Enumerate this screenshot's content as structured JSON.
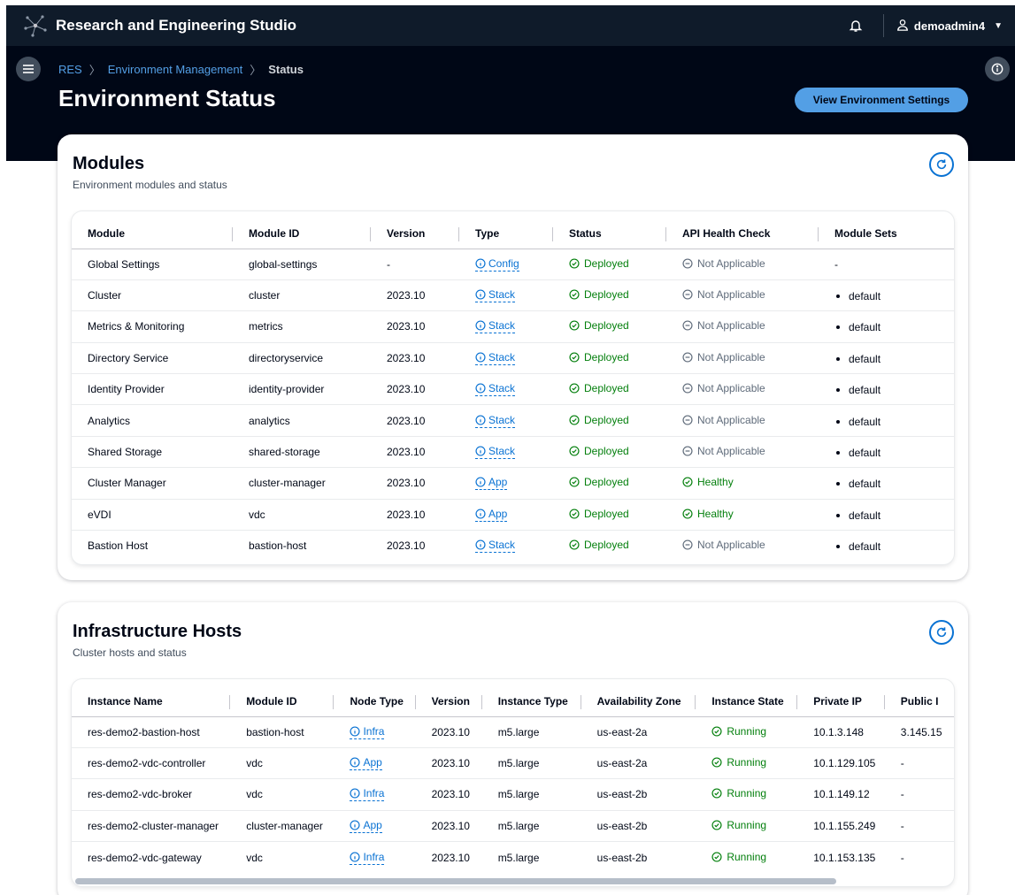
{
  "topnav": {
    "title": "Research and Engineering Studio",
    "user": "demoadmin4"
  },
  "breadcrumb": {
    "root": "RES",
    "parent": "Environment Management",
    "current": "Status"
  },
  "page": {
    "title": "Environment Status",
    "primary_button": "View Environment Settings"
  },
  "modules": {
    "title": "Modules",
    "description": "Environment modules and status",
    "columns": [
      "Module",
      "Module ID",
      "Version",
      "Type",
      "Status",
      "API Health Check",
      "Module Sets"
    ],
    "rows": [
      [
        "Global Settings",
        "global-settings",
        "-",
        "Config",
        "Deployed",
        "Not Applicable",
        "-"
      ],
      [
        "Cluster",
        "cluster",
        "2023.10",
        "Stack",
        "Deployed",
        "Not Applicable",
        "default"
      ],
      [
        "Metrics & Monitoring",
        "metrics",
        "2023.10",
        "Stack",
        "Deployed",
        "Not Applicable",
        "default"
      ],
      [
        "Directory Service",
        "directoryservice",
        "2023.10",
        "Stack",
        "Deployed",
        "Not Applicable",
        "default"
      ],
      [
        "Identity Provider",
        "identity-provider",
        "2023.10",
        "Stack",
        "Deployed",
        "Not Applicable",
        "default"
      ],
      [
        "Analytics",
        "analytics",
        "2023.10",
        "Stack",
        "Deployed",
        "Not Applicable",
        "default"
      ],
      [
        "Shared Storage",
        "shared-storage",
        "2023.10",
        "Stack",
        "Deployed",
        "Not Applicable",
        "default"
      ],
      [
        "Cluster Manager",
        "cluster-manager",
        "2023.10",
        "App",
        "Deployed",
        "Healthy",
        "default"
      ],
      [
        "eVDI",
        "vdc",
        "2023.10",
        "App",
        "Deployed",
        "Healthy",
        "default"
      ],
      [
        "Bastion Host",
        "bastion-host",
        "2023.10",
        "Stack",
        "Deployed",
        "Not Applicable",
        "default"
      ]
    ]
  },
  "hosts": {
    "title": "Infrastructure Hosts",
    "description": "Cluster hosts and status",
    "columns": [
      "Instance Name",
      "Module ID",
      "Node Type",
      "Version",
      "Instance Type",
      "Availability Zone",
      "Instance State",
      "Private IP",
      "Public I"
    ],
    "rows": [
      [
        "res-demo2-bastion-host",
        "bastion-host",
        "Infra",
        "2023.10",
        "m5.large",
        "us-east-2a",
        "Running",
        "10.1.3.148",
        "3.145.15"
      ],
      [
        "res-demo2-vdc-controller",
        "vdc",
        "App",
        "2023.10",
        "m5.large",
        "us-east-2a",
        "Running",
        "10.1.129.105",
        "-"
      ],
      [
        "res-demo2-vdc-broker",
        "vdc",
        "Infra",
        "2023.10",
        "m5.large",
        "us-east-2b",
        "Running",
        "10.1.149.12",
        "-"
      ],
      [
        "res-demo2-cluster-manager",
        "cluster-manager",
        "App",
        "2023.10",
        "m5.large",
        "us-east-2b",
        "Running",
        "10.1.155.249",
        "-"
      ],
      [
        "res-demo2-vdc-gateway",
        "vdc",
        "Infra",
        "2023.10",
        "m5.large",
        "us-east-2b",
        "Running",
        "10.1.153.135",
        "-"
      ]
    ]
  },
  "colors": {
    "nav": "#0f1b2a",
    "header": "#000716",
    "accent": "#539fe5",
    "link": "#0972d3",
    "success": "#037f0c",
    "muted": "#5f6b7a"
  },
  "icons": {
    "logo": "network-logo-icon",
    "notifications": "bell-icon",
    "user": "user-icon",
    "menu": "hamburger-menu-icon",
    "info": "info-icon",
    "refresh": "refresh-icon",
    "type": "info-circle-icon",
    "status_ok": "check-circle-icon",
    "status_na": "minus-circle-icon"
  }
}
